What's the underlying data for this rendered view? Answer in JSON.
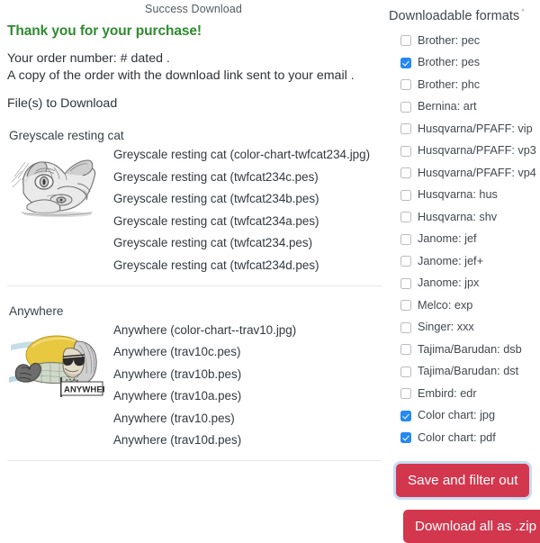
{
  "page": {
    "title": "Success Download",
    "thank_you": "Thank you for your purchase!",
    "order_line_1": "Your order number: # dated .",
    "order_line_2": "A copy of the order with the download link sent to your email .",
    "files_heading": "File(s) to Download"
  },
  "products": [
    {
      "name": "Greyscale resting cat",
      "thumb_name": "greyscale-resting-cat-thumbnail",
      "files": [
        "Greyscale resting cat (color-chart-twfcat234.jpg)",
        "Greyscale resting cat (twfcat234c.pes)",
        "Greyscale resting cat (twfcat234b.pes)",
        "Greyscale resting cat (twfcat234a.pes)",
        "Greyscale resting cat (twfcat234.pes)",
        "Greyscale resting cat (twfcat234d.pes)"
      ]
    },
    {
      "name": "Anywhere",
      "thumb_name": "anywhere-thumbnail",
      "files": [
        "Anywhere (color-chart--trav10.jpg)",
        "Anywhere (trav10c.pes)",
        "Anywhere (trav10b.pes)",
        "Anywhere (trav10a.pes)",
        "Anywhere (trav10.pes)",
        "Anywhere (trav10d.pes)"
      ]
    }
  ],
  "formats": {
    "heading": "Downloadable formats",
    "required_mark": "*",
    "options": [
      {
        "label": "Brother: pec",
        "checked": false
      },
      {
        "label": "Brother: pes",
        "checked": true
      },
      {
        "label": "Brother: phc",
        "checked": false
      },
      {
        "label": "Bernina: art",
        "checked": false
      },
      {
        "label": "Husqvarna/PFAFF: vip",
        "checked": false
      },
      {
        "label": "Husqvarna/PFAFF: vp3",
        "checked": false
      },
      {
        "label": "Husqvarna/PFAFF: vp4",
        "checked": false
      },
      {
        "label": "Husqvarna: hus",
        "checked": false
      },
      {
        "label": "Husqvarna: shv",
        "checked": false
      },
      {
        "label": "Janome: jef",
        "checked": false
      },
      {
        "label": "Janome: jef+",
        "checked": false
      },
      {
        "label": "Janome: jpx",
        "checked": false
      },
      {
        "label": "Melco: exp",
        "checked": false
      },
      {
        "label": "Singer: xxx",
        "checked": false
      },
      {
        "label": "Tajima/Barudan: dsb",
        "checked": false
      },
      {
        "label": "Tajima/Barudan: dst",
        "checked": false
      },
      {
        "label": "Embird: edr",
        "checked": false
      },
      {
        "label": "Color chart: jpg",
        "checked": true
      },
      {
        "label": "Color chart: pdf",
        "checked": true
      }
    ]
  },
  "buttons": {
    "save": "Save and filter out",
    "download_zip": "Download all as .zip"
  },
  "colors": {
    "heading_green": "#2f8a2f",
    "button_red": "#d3374e",
    "checkbox_blue": "#2489f2",
    "focus_ring": "#c9dcf5"
  }
}
